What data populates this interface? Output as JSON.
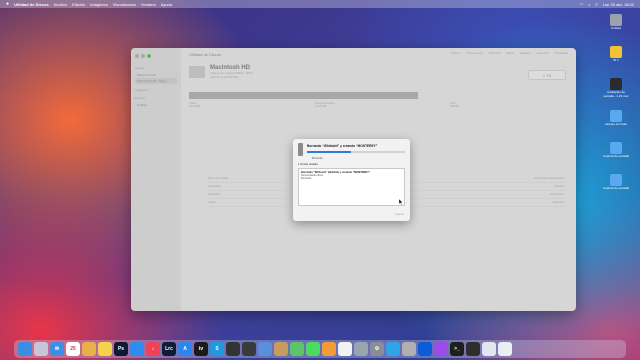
{
  "menubar": {
    "apple": "",
    "app": "Utilidad de Discos",
    "items": [
      "Archivo",
      "Edición",
      "Imágenes",
      "Visualización",
      "Ventana",
      "Ayuda"
    ],
    "clock": "Lun 25 abr. 18:02"
  },
  "desktop": {
    "icons": [
      {
        "label": "Untitled",
        "color": "#9aa3ad"
      },
      {
        "label": "IR 1",
        "color": "#f1c232"
      },
      {
        "label": "Grabación de pantalla...1.22.mov",
        "color": "#2b2b2b"
      },
      {
        "label": "carpeta sin título",
        "color": "#5aa9f0"
      },
      {
        "label": "Captura de pantalla",
        "color": "#5aa9f0"
      },
      {
        "label": "Captura de pantalla",
        "color": "#5aa9f0"
      }
    ]
  },
  "window": {
    "title": "Utilidad de Discos",
    "sidebar": {
      "section_internal": "Interno",
      "items": [
        "Macintosh HD",
        "Macintosh HD - Datos"
      ],
      "section_images": "Imágenes",
      "section_external": "Externo",
      "external_items": [
        "Untitled"
      ]
    },
    "toolbar": [
      "Volumen",
      "Primera ayuda",
      "Particionar",
      "Borrar",
      "Restaurar",
      "Desmontar",
      "Información"
    ],
    "disk": {
      "name": "Macintosh HD",
      "subtitle": "Volumen de sistema APFS · APFS",
      "subtitle2": "macOS 11.6 (20G165)",
      "capacity": "1 TB",
      "capacity_sub": "COMPARTIDO POR 5 VOLÚMENES"
    },
    "legend": [
      {
        "label": "Usado",
        "value": "15,25 GB"
      },
      {
        "label": "Otros volúmenes",
        "value": "22,22 GB"
      },
      {
        "label": "Libre",
        "value": "463 GB"
      }
    ],
    "info_rows": [
      {
        "k": "Punto de montaje",
        "v": "/",
        "k2": "Tipo",
        "v2": "Volumen de sistema APFS"
      },
      {
        "k": "Capacidad",
        "v": "1 TB",
        "k2": "Propietarios",
        "v2": "Activado"
      },
      {
        "k": "Disponible",
        "v": "",
        "k2": "Conexión",
        "v2": "PCI Express"
      },
      {
        "k": "Usado",
        "v": "",
        "k2": "Dispositivo",
        "v2": "disk1s5s1"
      }
    ]
  },
  "modal": {
    "title": "Borrando “Whitstott” y creando “MONTEREY”",
    "progress": 0.45,
    "status": "Borrando",
    "details_toggle": "Ocultar detalles",
    "details_title": "Borrando “Whitstott” (disk5s1) y creando “MONTEREY”",
    "details_lines": [
      "Desmontando disco",
      "Borrando"
    ],
    "button": "Aceptar"
  },
  "dock": {
    "icons": [
      {
        "name": "finder",
        "color": "#3a8de0",
        "glyph": ""
      },
      {
        "name": "launchpad",
        "color": "#c6c6d8",
        "glyph": ""
      },
      {
        "name": "mail",
        "color": "#3f8ee6",
        "glyph": "✉"
      },
      {
        "name": "calendar",
        "color": "#ffffff",
        "glyph": "25"
      },
      {
        "name": "photos",
        "color": "#e8b14a",
        "glyph": ""
      },
      {
        "name": "notes",
        "color": "#f4d24c",
        "glyph": ""
      },
      {
        "name": "photoshop",
        "color": "#0d1a35",
        "glyph": "Ps"
      },
      {
        "name": "safari",
        "color": "#2d8cf0",
        "glyph": ""
      },
      {
        "name": "music",
        "color": "#f1415a",
        "glyph": "♪"
      },
      {
        "name": "lightroom-classic",
        "color": "#0e1d35",
        "glyph": "Lrc"
      },
      {
        "name": "app-store",
        "color": "#2d86f0",
        "glyph": "A"
      },
      {
        "name": "apple-tv",
        "color": "#1a1a1a",
        "glyph": "tv"
      },
      {
        "name": "skype",
        "color": "#1f9ae0",
        "glyph": "S"
      },
      {
        "name": "davinci",
        "color": "#333333",
        "glyph": ""
      },
      {
        "name": "final-cut",
        "color": "#3a3a3a",
        "glyph": ""
      },
      {
        "name": "quicktime",
        "color": "#5b8fd9",
        "glyph": ""
      },
      {
        "name": "automator",
        "color": "#c79a5e",
        "glyph": ""
      },
      {
        "name": "maps",
        "color": "#5ec46a",
        "glyph": ""
      },
      {
        "name": "messages",
        "color": "#4cd964",
        "glyph": ""
      },
      {
        "name": "home",
        "color": "#f29b38",
        "glyph": ""
      },
      {
        "name": "chrome",
        "color": "#f2f2f2",
        "glyph": ""
      },
      {
        "name": "disk-utility",
        "color": "#9aa4b0",
        "glyph": ""
      },
      {
        "name": "system-preferences",
        "color": "#8c8c96",
        "glyph": "⚙"
      },
      {
        "name": "telegram",
        "color": "#2fa4e7",
        "glyph": ""
      },
      {
        "name": "boot-camp",
        "color": "#b0b0b0",
        "glyph": ""
      },
      {
        "name": "1password",
        "color": "#0b5cd6",
        "glyph": ""
      },
      {
        "name": "podcasts",
        "color": "#9b4ce6",
        "glyph": ""
      },
      {
        "name": "terminal",
        "color": "#1e1e1e",
        "glyph": ">_"
      },
      {
        "name": "activity-monitor",
        "color": "#2e2e2e",
        "glyph": ""
      },
      {
        "name": "preview",
        "color": "#dfe7f0",
        "glyph": ""
      },
      {
        "name": "trash",
        "color": "#e8eef4",
        "glyph": ""
      }
    ]
  }
}
